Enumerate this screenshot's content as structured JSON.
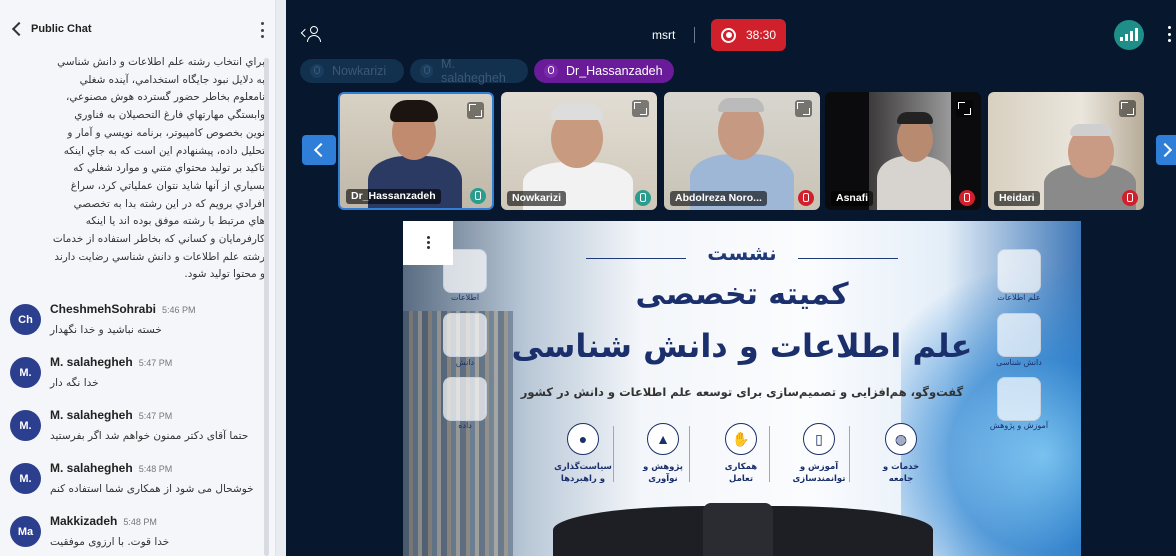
{
  "chat": {
    "title": "Public Chat",
    "previous_message_lines": [
      "براي انتخاب رشته علم اطلاعات و دانش شناسي",
      "به دلايل نبود جايگاه استخدامي، آينده شغلي",
      "نامعلوم بخاطر حضور گسترده هوش مصنوعي،",
      "وابستگي مهارتهاي فارغ التحصيلان به فناوري",
      "نوين بخصوص كامپيوتر، برنامه نويسي و آمار و",
      "تحليل داده، پيشنهادم اين است كه به جاي اينكه",
      "تاكيد بر توليد محتواي متني و موارد شغلي كه",
      "بسياري از آنها شايد نتوان عملياتي كرد، سراغ",
      "افرادي برويم كه در اين رشته بدا به تخصصي",
      "هاي مرتبط با رشته موفق بوده اند يا اينكه",
      "كارفرمايان و كساني كه بخاطر استفاده از خدمات",
      "رشته علم اطلاعات و دانش شناسي رضايت دارند",
      "و محتوا توليد شود."
    ],
    "messages": [
      {
        "initials": "Ch",
        "name": "CheshmehSohrabi",
        "time": "5:46 PM",
        "text": "خسته نباشيد و خدا نگهدار"
      },
      {
        "initials": "M.",
        "name": "M. salahegheh",
        "time": "5:47 PM",
        "text": "خدا نگه دار"
      },
      {
        "initials": "M.",
        "name": "M. salahegheh",
        "time": "5:47 PM",
        "text": "حتما آقای دکتر ممنون خواهم شد اگر بفرستید"
      },
      {
        "initials": "M.",
        "name": "M. salahegheh",
        "time": "5:48 PM",
        "text": "خوشحال می شود از همکاری شما استفاده کنم"
      },
      {
        "initials": "Ma",
        "name": "Makkizadeh",
        "time": "5:48 PM",
        "text": "خدا قوت. با ارزوی موفقیت"
      }
    ]
  },
  "toolbar": {
    "meeting_name": "msrt",
    "recording_time": "38:30"
  },
  "speakers": [
    {
      "name": "Nowkarizi",
      "talking": false
    },
    {
      "name": "M. salahegheh",
      "talking": false
    },
    {
      "name": "Dr_Hassanzadeh",
      "talking": true
    }
  ],
  "video_tiles": [
    {
      "name": "Dr_Hassanzadeh",
      "mic": "on",
      "active": true
    },
    {
      "name": "Nowkarizi",
      "mic": "on",
      "active": false
    },
    {
      "name": "Abdolreza Noro...",
      "mic": "off",
      "active": false
    },
    {
      "name": "Asnafi",
      "mic": "off",
      "active": false
    },
    {
      "name": "Heidari",
      "mic": "off",
      "active": false
    }
  ],
  "slide": {
    "kicker": "نشست",
    "title_line1": "کمیته تخصصی",
    "title_line2": "علم اطلاعات و دانش شناسی",
    "subtitle": "گفت‌وگو، هم‌افزایی و تصمیم‌سازی برای توسعه علم اطلاعات و دانش در کشور",
    "left_icons": [
      "اطلاعات",
      "دانش",
      "داده"
    ],
    "right_icons": [
      "علم اطلاعات",
      "دانش شناسی",
      "آموزش و پژوهش"
    ],
    "features": [
      {
        "label": "خدمات و\nجامعه",
        "icon": "globe-icon"
      },
      {
        "label": "آموزش و\nتوانمندسازی",
        "icon": "book-icon"
      },
      {
        "label": "همکاری\nتعامل",
        "icon": "handshake-icon"
      },
      {
        "label": "پژوهش و\nنوآوری",
        "icon": "chart-icon"
      },
      {
        "label": "سیاست‌گذاری\nو راهبردها",
        "icon": "people-icon"
      }
    ]
  },
  "colors": {
    "accent": "#2f7ed8",
    "record": "#d0202b",
    "talking": "#6a1b9a",
    "avatar": "#2c3f8e"
  }
}
